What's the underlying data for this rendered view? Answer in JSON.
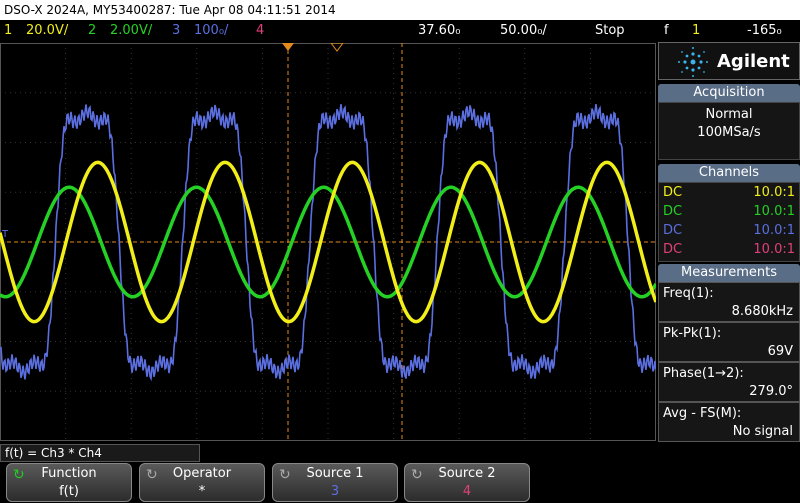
{
  "title_bar": "DSO-X 2024A, MY53400287: Tue Apr 08 04:11:51 2014",
  "status": {
    "ch1_num": "1",
    "ch1_scale": "20.0V/",
    "ch2_num": "2",
    "ch2_scale": "2.00V/",
    "ch3_num": "3",
    "ch3_scale": "100₀/",
    "ch4_num": "4",
    "timebase": "37.60₀",
    "delay": "50.00₀/",
    "run_state": "Stop",
    "trig_icon": "f",
    "trig_ch": "1",
    "trig_level": "-165₀"
  },
  "colors": {
    "ch1": "#f2ee1a",
    "ch2": "#26d126",
    "ch3": "#5b6fe0",
    "ch4": "#e0407a",
    "grid": "#555",
    "cursor": "#e58a1c"
  },
  "brand": "Agilent",
  "acquisition": {
    "header": "Acquisition",
    "mode": "Normal",
    "rate": "100MSa/s"
  },
  "channels": {
    "header": "Channels",
    "rows": [
      {
        "coupling": "DC",
        "probe": "10.0:1"
      },
      {
        "coupling": "DC",
        "probe": "10.0:1"
      },
      {
        "coupling": "DC",
        "probe": "10.0:1"
      },
      {
        "coupling": "DC",
        "probe": "10.0:1"
      }
    ]
  },
  "measurements": {
    "header": "Measurements",
    "items": [
      {
        "label": "Freq(1):",
        "value": "8.680kHz"
      },
      {
        "label": "Pk-Pk(1):",
        "value": "69V"
      },
      {
        "label": "Phase(1→2):",
        "value": "279.0°"
      },
      {
        "label": "Avg - FS(M):",
        "value": "No signal"
      }
    ]
  },
  "function_bar": "f(t) = Ch3 * Ch4",
  "softkeys": [
    {
      "title": "Function",
      "value": "f(t)"
    },
    {
      "title": "Operator",
      "value": "*"
    },
    {
      "title": "Source 1",
      "value": "3"
    },
    {
      "title": "Source 2",
      "value": "4"
    }
  ],
  "waveforms": {
    "ch1": {
      "period_div": 1.94,
      "amplitude_div": 1.6,
      "phase_deg": 0
    },
    "ch2": {
      "period_div": 1.94,
      "amplitude_div": 1.1,
      "phase_deg": 279
    },
    "ch3": {
      "period_div": 1.94,
      "amplitude_div": 3.6,
      "phase_deg": 330
    }
  }
}
